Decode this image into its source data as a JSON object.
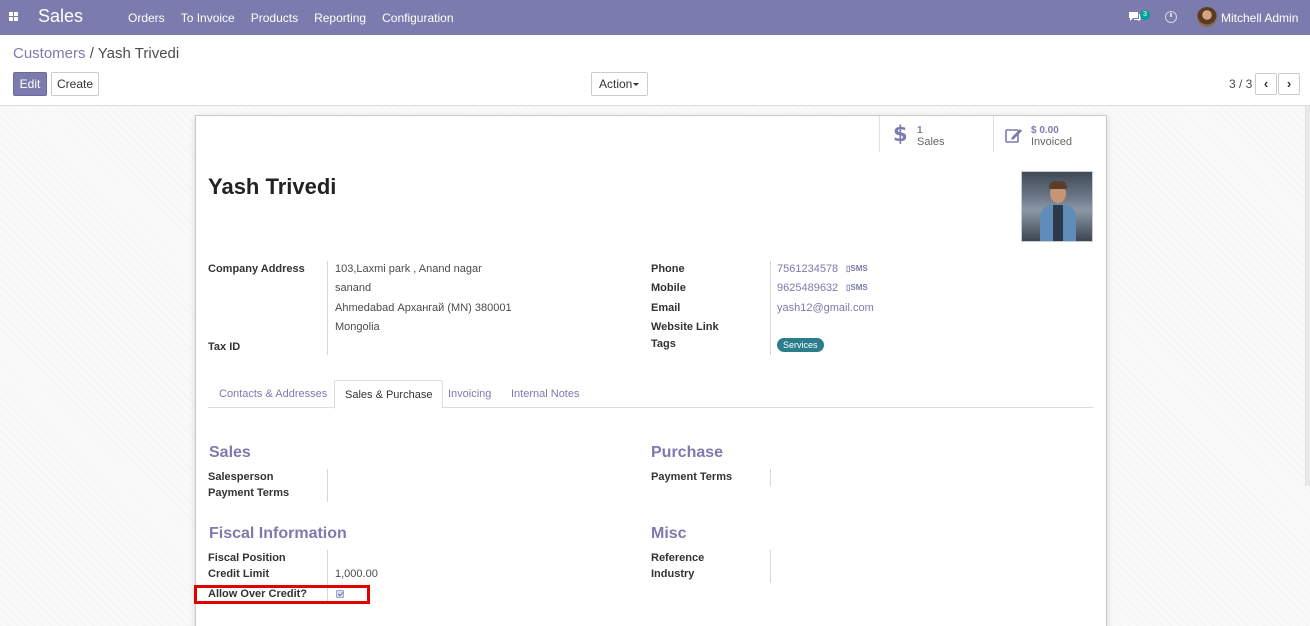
{
  "navbar": {
    "app_name": "Sales",
    "menu": [
      "Orders",
      "To Invoice",
      "Products",
      "Reporting",
      "Configuration"
    ],
    "chat_count": "3",
    "user_name": "Mitchell Admin"
  },
  "control_panel": {
    "breadcrumb_parent": "Customers",
    "breadcrumb_separator": "/",
    "breadcrumb_current": "Yash Trivedi",
    "edit_label": "Edit",
    "create_label": "Create",
    "action_label": "Action",
    "pager": "3 / 3",
    "pager_prev": "‹",
    "pager_next": "›"
  },
  "stat_buttons": [
    {
      "value": "1",
      "label": "Sales",
      "icon": "dollar-icon"
    },
    {
      "value": "$ 0.00",
      "label": "Invoiced",
      "icon": "edit-icon"
    }
  ],
  "partner": {
    "name": "Yash Trivedi"
  },
  "fields_left": {
    "company_address_label": "Company Address",
    "address_lines": [
      "103,Laxmi park , Anand nagar",
      "sanand",
      "Ahmedabad  Архангай (MN)  380001",
      "Mongolia"
    ],
    "tax_id_label": "Tax ID"
  },
  "fields_right": {
    "phone_label": "Phone",
    "phone_value": "7561234578",
    "mobile_label": "Mobile",
    "mobile_value": "9625489632",
    "sms_label": "SMS",
    "email_label": "Email",
    "email_value": "yash12@gmail.com",
    "website_label": "Website Link",
    "tags_label": "Tags",
    "tag_value": "Services"
  },
  "tabs": [
    "Contacts & Addresses",
    "Sales & Purchase",
    "Invoicing",
    "Internal Notes"
  ],
  "active_tab": "Sales & Purchase",
  "sales_section": {
    "title": "Sales",
    "salesperson_label": "Salesperson",
    "payment_terms_label": "Payment Terms"
  },
  "purchase_section": {
    "title": "Purchase",
    "payment_terms_label": "Payment Terms"
  },
  "fiscal_section": {
    "title": "Fiscal Information",
    "fiscal_position_label": "Fiscal Position",
    "credit_limit_label": "Credit Limit",
    "credit_limit_value": "1,000.00",
    "allow_over_credit_label": "Allow Over Credit?",
    "allow_over_credit_checked": true
  },
  "misc_section": {
    "title": "Misc",
    "reference_label": "Reference",
    "industry_label": "Industry"
  },
  "colors": {
    "brand": "#7c7bad",
    "highlight": "#e00000",
    "tag": "#2c7e8c"
  }
}
